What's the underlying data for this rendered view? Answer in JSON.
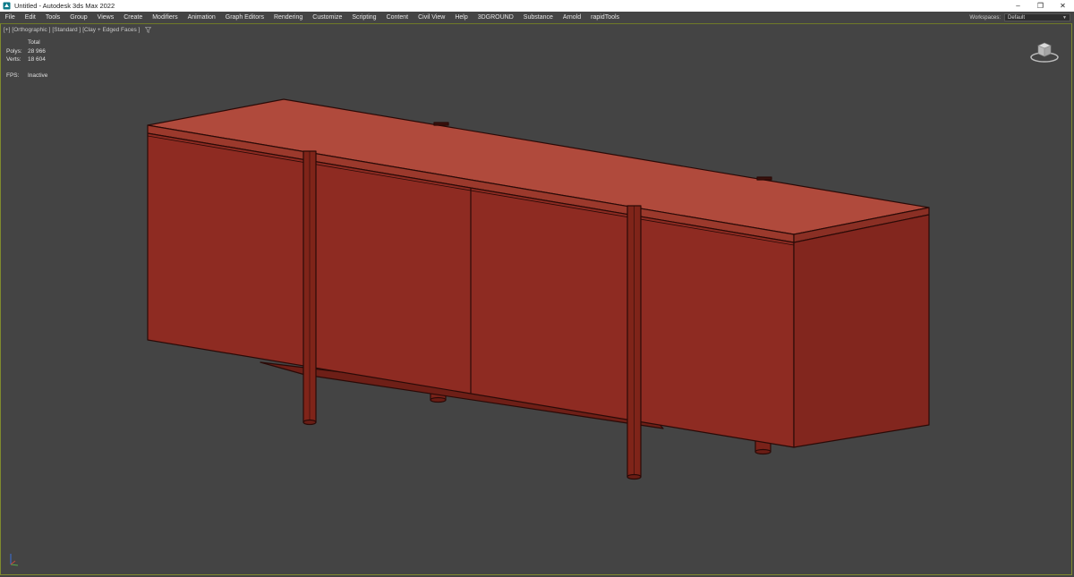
{
  "window": {
    "title": "Untitled - Autodesk 3ds Max 2022",
    "minimize": "–",
    "restore": "❐",
    "close": "✕"
  },
  "menu": {
    "items": [
      "File",
      "Edit",
      "Tools",
      "Group",
      "Views",
      "Create",
      "Modifiers",
      "Animation",
      "Graph Editors",
      "Rendering",
      "Customize",
      "Scripting",
      "Content",
      "Civil View",
      "Help",
      "3DGROUND",
      "Substance",
      "Arnold",
      "rapidTools"
    ]
  },
  "workspaces": {
    "label": "Workspaces:",
    "value": "Default"
  },
  "viewport": {
    "label_plus": "[+]",
    "label_view": "[Orthographic ]",
    "label_shading": "[Standard ]",
    "label_style": "[Clay + Edged Faces ]",
    "filter_icon": "funnel-icon"
  },
  "stats": {
    "header": "Total",
    "polys_label": "Polys:",
    "polys_value": "28 966",
    "verts_label": "Verts:",
    "verts_value": "18 604",
    "fps_label": "FPS:",
    "fps_value": "Inactive"
  },
  "colors": {
    "viewport_bg": "#444444",
    "object_front": "#8e2b22",
    "object_top": "#b04a3c",
    "object_side": "#82261e",
    "edge": "#2a0a07",
    "viewport_border": "#7f8a2e"
  }
}
